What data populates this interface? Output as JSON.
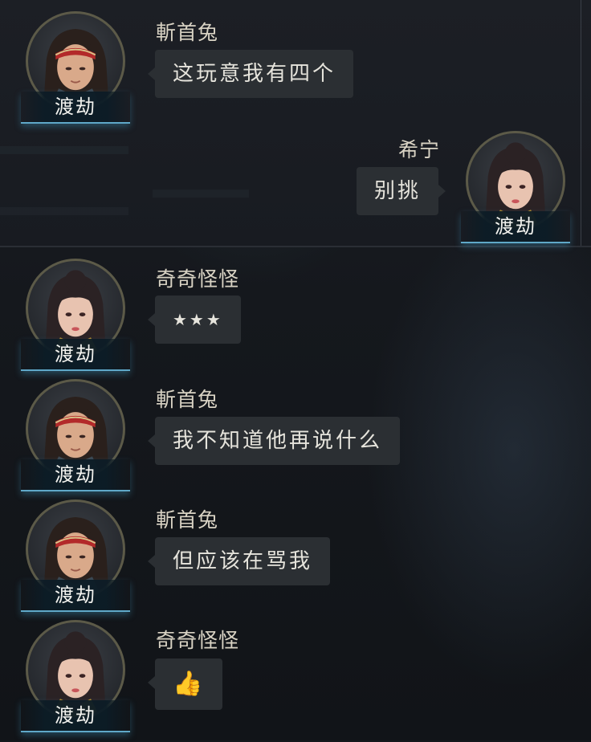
{
  "messages": [
    {
      "sender": "斬首兔",
      "text": "这玩意我有四个",
      "rank": "渡劫",
      "side": "left",
      "avatar": "male-headband-avatar"
    },
    {
      "sender": "希宁",
      "text": "别挑",
      "rank": "渡劫",
      "side": "right",
      "avatar": "female-avatar"
    },
    {
      "sender": "奇奇怪怪",
      "text": "★★★",
      "rank": "渡劫",
      "side": "left",
      "avatar": "female-avatar"
    },
    {
      "sender": "斬首兔",
      "text": "我不知道他再说什么",
      "rank": "渡劫",
      "side": "left",
      "avatar": "male-headband-avatar"
    },
    {
      "sender": "斬首兔",
      "text": "但应该在骂我",
      "rank": "渡劫",
      "side": "left",
      "avatar": "male-headband-avatar"
    },
    {
      "sender": "奇奇怪怪",
      "text": "👍",
      "rank": "渡劫",
      "side": "left",
      "avatar": "female-avatar",
      "icon": "thumbs-up-icon"
    }
  ],
  "colors": {
    "bubble": "#2b2f33",
    "sender_name": "#d9d3c4",
    "rank_underline": "#5fa8c8",
    "avatar_ring": "#5c5a48"
  }
}
